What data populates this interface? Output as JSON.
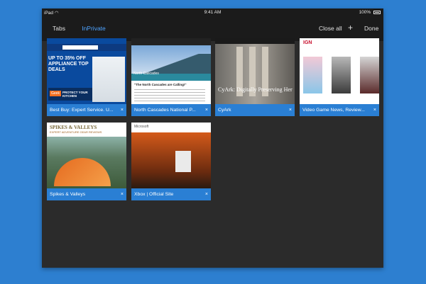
{
  "status_bar": {
    "device": "iPad",
    "wifi_icon": "wifi-icon",
    "time": "9:41 AM",
    "battery": "100%"
  },
  "toolbar": {
    "tabs_label": "Tabs",
    "inprivate_label": "InPrivate",
    "close_all_label": "Close all",
    "new_tab_symbol": "+",
    "done_label": "Done"
  },
  "tabs": [
    {
      "title": "Best Buy: Expert Service. U...",
      "close": "×",
      "preview": {
        "promo": "UP TO 35% OFF APPLIANCE TOP DEALS",
        "badge": "Geek",
        "badge_text": "PROTECT YOUR KITCHEN"
      }
    },
    {
      "title": "North Cascades National P...",
      "close": "×",
      "preview": {
        "heading": "\"The North Cascades are Calling!\"",
        "overlay": "North Cascades"
      }
    },
    {
      "title": "CyArk",
      "close": "×",
      "preview": {
        "headline": "CyArk: Digitally Preserving Her"
      }
    },
    {
      "title": "Video Game News, Review...",
      "close": "×",
      "preview": {
        "logo": "IGN"
      }
    },
    {
      "title": "Spikes & Valleys",
      "close": "×",
      "preview": {
        "brand": "SPIKES & VALLEYS",
        "tagline": "EXPERT ADVENTURE GEAR REVIEWS"
      }
    },
    {
      "title": "Xbox | Official Site",
      "close": "×",
      "preview": {
        "brand": "Microsoft"
      }
    }
  ],
  "colors": {
    "accent": "#4ea3ff",
    "card_bar": "#2a7fd4",
    "background": "#2d7fd0",
    "panel": "#2b2b2b",
    "toolbar": "#1b1b1b"
  }
}
